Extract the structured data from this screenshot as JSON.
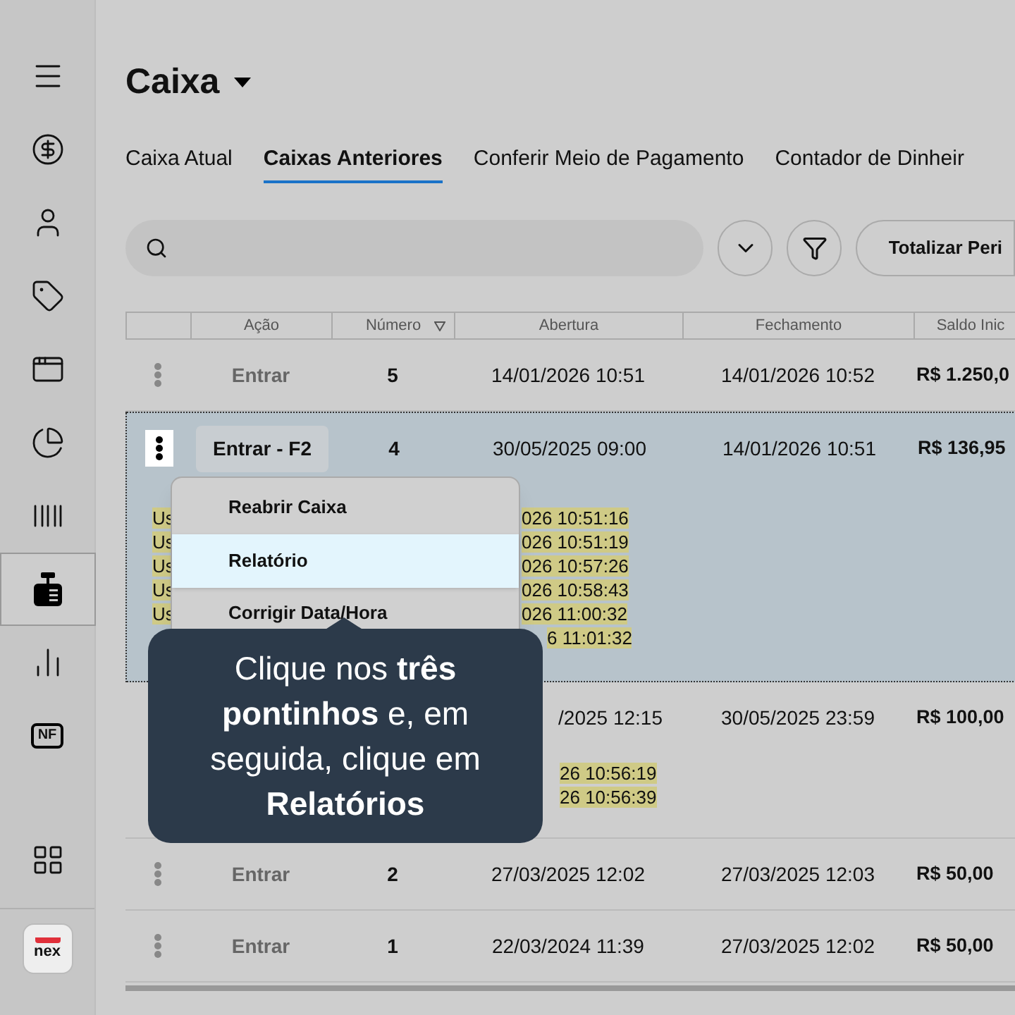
{
  "sidebar": {
    "items": [
      {
        "kind": "menu",
        "selected": false
      },
      {
        "kind": "money",
        "selected": false
      },
      {
        "kind": "user",
        "selected": false
      },
      {
        "kind": "tag",
        "selected": false
      },
      {
        "kind": "box",
        "selected": false
      },
      {
        "kind": "pie",
        "selected": false
      },
      {
        "kind": "barcode",
        "selected": false
      },
      {
        "kind": "register",
        "selected": true
      },
      {
        "kind": "chart",
        "selected": false
      },
      {
        "kind": "nf",
        "label": "NF",
        "selected": false
      },
      {
        "kind": "apps",
        "selected": false
      }
    ],
    "logo": "nex"
  },
  "title": "Caixa",
  "tabs": [
    {
      "label": "Caixa Atual",
      "selected": false
    },
    {
      "label": "Caixas Anteriores",
      "selected": true
    },
    {
      "label": "Conferir Meio de Pagamento",
      "selected": false
    },
    {
      "label": "Contador de Dinheir",
      "selected": false
    }
  ],
  "toolbar": {
    "total_button": "Totalizar Peri"
  },
  "table": {
    "columns": [
      "Ação",
      "Número",
      "Abertura",
      "Fechamento",
      "Saldo Inic"
    ],
    "rows": [
      {
        "action": "Entrar",
        "number": "5",
        "abertura": "14/01/2026 10:51",
        "fechamento": "14/01/2026 10:52",
        "saldo": "R$ 1.250,0",
        "selected": false
      },
      {
        "action": "Entrar - F2",
        "number": "4",
        "abertura": "30/05/2025 09:00",
        "fechamento": "14/01/2026 10:51",
        "saldo": "R$ 136,95",
        "selected": true,
        "logs": [
          {
            "prefix": "Us",
            "suffix": "026 10:51:16"
          },
          {
            "prefix": "Us",
            "suffix": "026 10:51:19"
          },
          {
            "prefix": "Us",
            "suffix": "026 10:57:26"
          },
          {
            "prefix": "Us",
            "suffix": "026 10:58:43"
          },
          {
            "prefix": "Us",
            "suffix": "026 11:00:32"
          },
          {
            "suffix": "6 11:01:32"
          }
        ]
      },
      {
        "abertura": "/2025 12:15",
        "fechamento": "30/05/2025 23:59",
        "saldo": "R$ 100,00",
        "selected": false,
        "logs": [
          {
            "suffix": "26 10:56:19"
          },
          {
            "suffix": "26 10:56:39"
          }
        ]
      },
      {
        "action": "Entrar",
        "number": "2",
        "abertura": "27/03/2025 12:02",
        "fechamento": "27/03/2025 12:03",
        "saldo": "R$ 50,00",
        "selected": false
      },
      {
        "action": "Entrar",
        "number": "1",
        "abertura": "22/03/2024 11:39",
        "fechamento": "27/03/2025 12:02",
        "saldo": "R$ 50,00",
        "selected": false
      }
    ]
  },
  "menu": {
    "items": [
      {
        "label": "Reabrir Caixa",
        "selected": false
      },
      {
        "label": "Relatório",
        "selected": true
      },
      {
        "label": "Corrigir Data/Hora",
        "selected": false
      }
    ]
  },
  "tooltip": {
    "text": "Clique nos **três pontinhos** e, em seguida, clique em **Relatórios**"
  }
}
